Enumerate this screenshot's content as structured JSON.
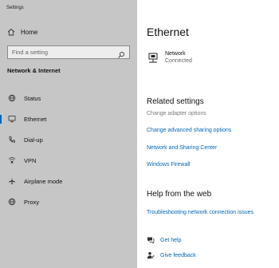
{
  "window": {
    "title": "Settings"
  },
  "sidebar": {
    "home_label": "Home",
    "search_placeholder": "Find a setting",
    "section_title": "Network & Internet",
    "items": [
      {
        "label": "Status",
        "icon": "globe-status-icon"
      },
      {
        "label": "Ethernet",
        "icon": "monitor-icon",
        "active": true
      },
      {
        "label": "Dial-up",
        "icon": "phone-icon"
      },
      {
        "label": "VPN",
        "icon": "vpn-icon"
      },
      {
        "label": "Airplane mode",
        "icon": "airplane-icon"
      },
      {
        "label": "Proxy",
        "icon": "globe-icon"
      }
    ]
  },
  "main": {
    "title": "Ethernet",
    "network": {
      "name": "Network",
      "status": "Connected",
      "icon": "ethernet-icon"
    },
    "related": {
      "title": "Related settings",
      "links": [
        {
          "label": "Change adapter options",
          "disabled": true
        },
        {
          "label": "Change advanced sharing options"
        },
        {
          "label": "Network and Sharing Center"
        },
        {
          "label": "Windows Firewall"
        }
      ]
    },
    "help": {
      "title": "Help from the web",
      "link": "Troubleshooting network connection issues"
    },
    "footer": {
      "get_help": "Get help",
      "give_feedback": "Give feedback"
    }
  },
  "colors": {
    "sidebar_bg": "#c6c6c6",
    "accent": "#0067b8",
    "active_indicator": "#0063b1"
  }
}
